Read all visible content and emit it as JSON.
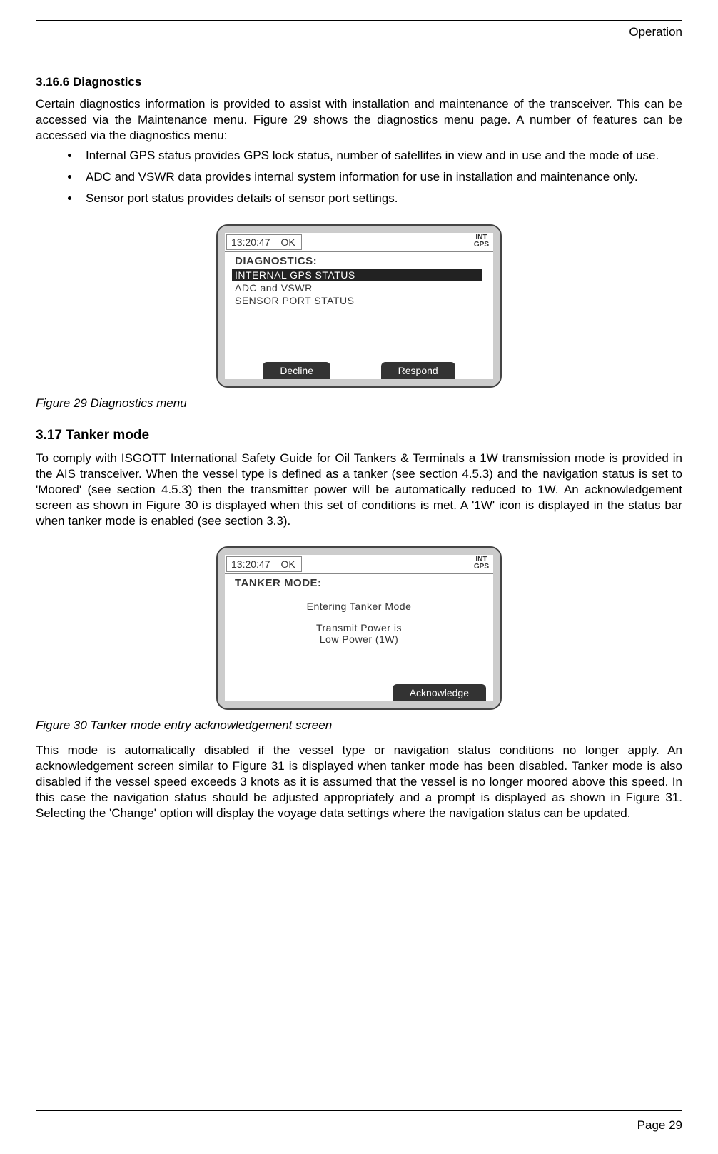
{
  "header": {
    "section": "Operation"
  },
  "sec_3_16_6": {
    "num_title": "3.16.6  Diagnostics",
    "para": "Certain diagnostics information is provided to assist with installation and maintenance of the transceiver. This can be accessed via the Maintenance menu. Figure 29 shows the diagnostics menu page. A number of features can be accessed via the diagnostics menu:",
    "bullets": [
      "Internal GPS status provides GPS lock status, number of satellites in view and in use and the mode of use.",
      "ADC and VSWR data provides internal system information for use in installation and maintenance only.",
      "Sensor port status provides details of sensor port settings."
    ]
  },
  "fig29": {
    "status_time": "13:20:47",
    "status_ok": "OK",
    "gps_line1": "INT",
    "gps_line2": "GPS",
    "title": "DIAGNOSTICS:",
    "items": {
      "0": "INTERNAL GPS STATUS",
      "1": "ADC and VSWR",
      "2": "SENSOR PORT STATUS"
    },
    "btn_left": "Decline",
    "btn_right": "Respond",
    "caption": "Figure 29   Diagnostics menu"
  },
  "sec_3_17": {
    "title": "3.17 Tanker mode",
    "para1": "To comply with ISGOTT International Safety Guide for Oil Tankers & Terminals a 1W transmission mode is provided in the AIS transceiver. When the vessel type is defined as a tanker (see section 4.5.3) and the navigation status is set to 'Moored' (see section 4.5.3) then the transmitter power will be automatically reduced to 1W. An acknowledgement screen as shown in Figure 30 is displayed when this set of conditions is met. A '1W' icon is displayed in the status bar when tanker mode is enabled (see section 3.3)."
  },
  "fig30": {
    "status_time": "13:20:47",
    "status_ok": "OK",
    "gps_line1": "INT",
    "gps_line2": "GPS",
    "title": "TANKER MODE:",
    "line1": "Entering Tanker Mode",
    "line2": "Transmit Power is",
    "line3": "Low Power (1W)",
    "btn": "Acknowledge",
    "caption": "Figure 30   Tanker mode entry acknowledgement screen"
  },
  "para_after_fig30": "This mode is automatically disabled if the vessel type or navigation status conditions no longer apply. An acknowledgement screen similar to Figure 31 is displayed when tanker mode has been disabled. Tanker mode is also disabled if the vessel speed exceeds 3 knots as it is assumed that the vessel is no longer moored above this speed. In this case the navigation status should be adjusted appropriately and a prompt is displayed as shown in Figure 31. Selecting the 'Change' option will display the voyage data settings where the navigation status can be updated.",
  "footer": {
    "page": "Page 29"
  }
}
